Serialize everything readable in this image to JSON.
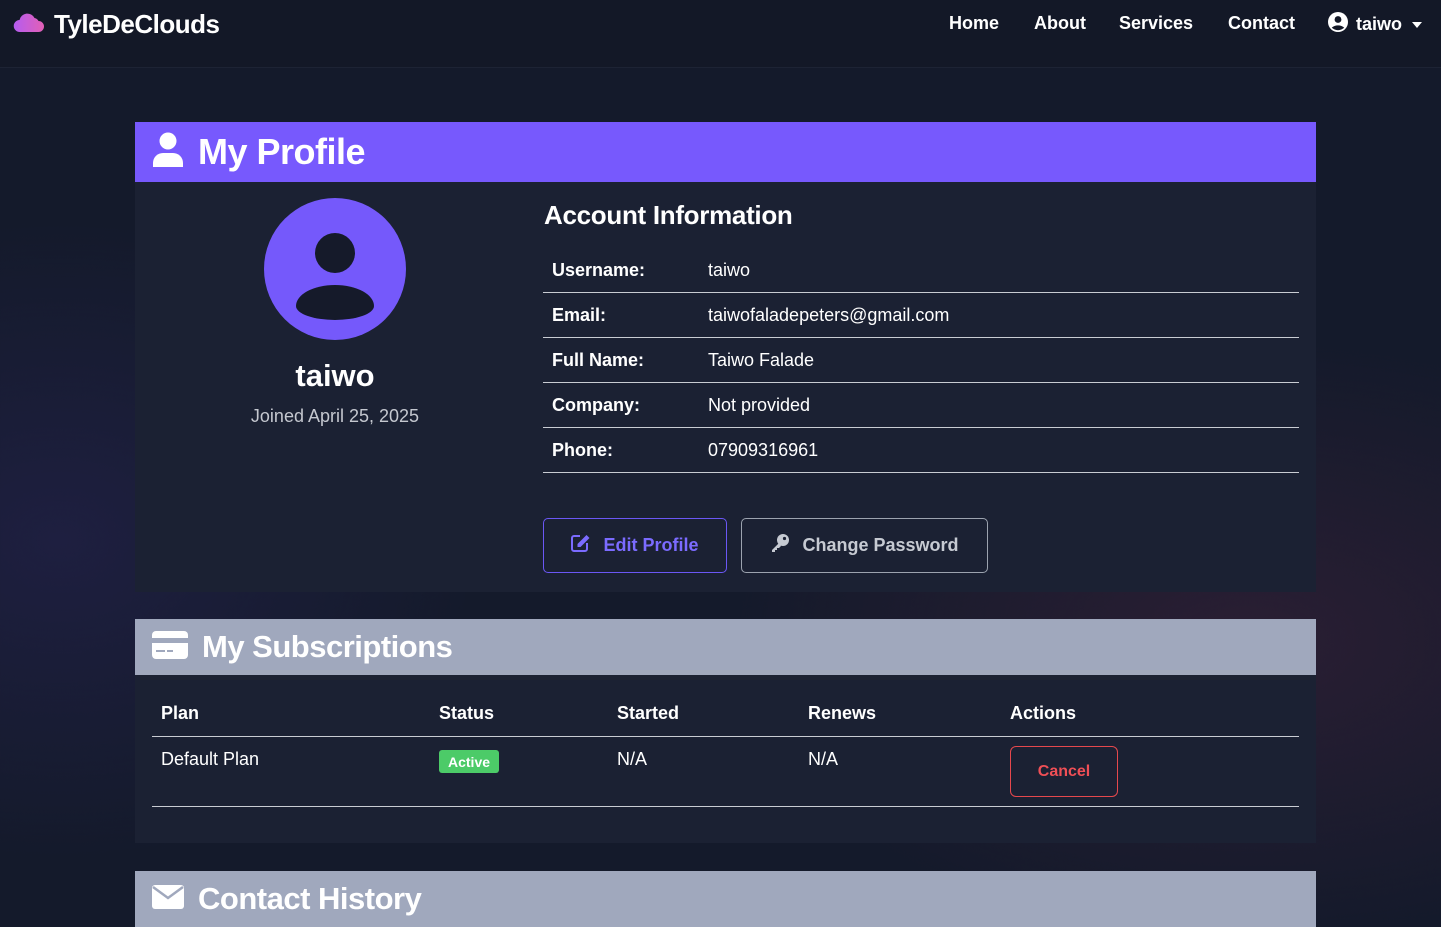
{
  "brand": {
    "name": "TyleDeClouds"
  },
  "nav": {
    "links": [
      "Home",
      "About",
      "Services",
      "Contact"
    ],
    "user": "taiwo"
  },
  "profile": {
    "header": "My Profile",
    "username_display": "taiwo",
    "joined": "Joined April 25, 2025",
    "account_title": "Account Information",
    "fields": [
      {
        "label": "Username:",
        "value": "taiwo"
      },
      {
        "label": "Email:",
        "value": "taiwofaladepeters@gmail.com"
      },
      {
        "label": "Full Name:",
        "value": "Taiwo Falade"
      },
      {
        "label": "Company:",
        "value": "Not provided"
      },
      {
        "label": "Phone:",
        "value": "07909316961"
      }
    ],
    "edit_label": "Edit Profile",
    "password_label": "Change Password"
  },
  "subscriptions": {
    "header": "My Subscriptions",
    "columns": [
      "Plan",
      "Status",
      "Started",
      "Renews",
      "Actions"
    ],
    "rows": [
      {
        "plan": "Default Plan",
        "status": "Active",
        "started": "N/A",
        "renews": "N/A",
        "action": "Cancel"
      }
    ]
  },
  "contact_history": {
    "header": "Contact History"
  },
  "colors": {
    "accent": "#7759fd",
    "section_header": "#a0a8bd",
    "success": "#4ccb68",
    "danger": "#e5484d",
    "background": "#141a2b",
    "card": "#1b2133"
  },
  "icons": [
    "cloud-icon",
    "user-circle-icon",
    "user-icon",
    "edit-icon",
    "key-icon",
    "credit-card-icon",
    "envelope-icon"
  ]
}
